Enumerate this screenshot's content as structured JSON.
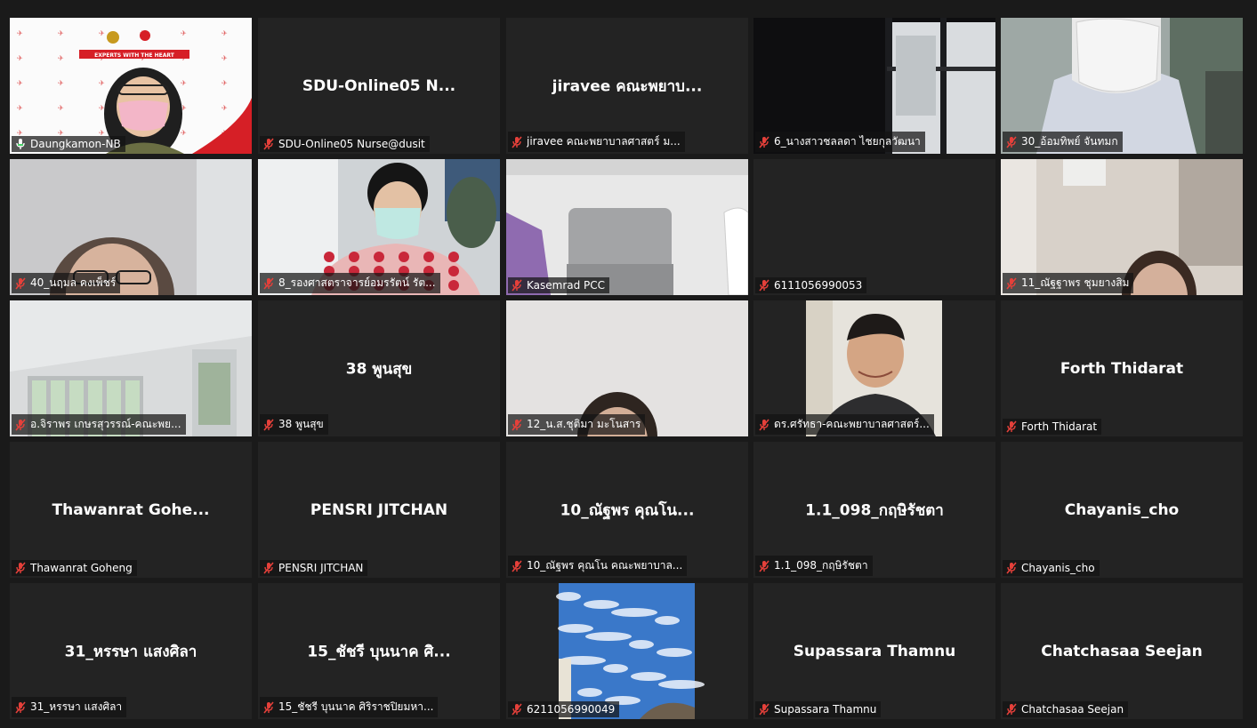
{
  "tiles": [
    {
      "name": "Daungkamon-NB",
      "display": "",
      "video": "speaker",
      "active": true,
      "mic": "active"
    },
    {
      "name": "SDU-Online05 Nurse@dusit",
      "display": "SDU-Online05  N...",
      "video": "none",
      "mic": "muted"
    },
    {
      "name": "jiravee คณะพยาบาลศาสตร์ ม...",
      "display": "jiravee คณะพยาบ...",
      "video": "none",
      "mic": "muted"
    },
    {
      "name": "6_นางสาวชลลดา  ไชยกุลวัฒนา",
      "display": "",
      "video": "window",
      "mic": "muted"
    },
    {
      "name": "30_อ้อมทิพย์  จันทมก",
      "display": "",
      "video": "mask",
      "mic": "muted"
    },
    {
      "name": "40_นฤมล คงเพ็ชร์",
      "display": "",
      "video": "face1",
      "mic": "muted"
    },
    {
      "name": "8_รองศาสตราจารย์อมรรัตน์ รัต...",
      "display": "",
      "video": "office",
      "mic": "muted"
    },
    {
      "name": "Kasemrad PCC",
      "display": "",
      "video": "chair",
      "mic": "muted"
    },
    {
      "name": "6111056990053",
      "display": "",
      "video": "black",
      "mic": "muted"
    },
    {
      "name": "11_ณัฐฐาพร ชุมยางสิม",
      "display": "",
      "video": "room",
      "mic": "muted"
    },
    {
      "name": "อ.จิราพร เกษรสุวรรณ์-คณะพย...",
      "display": "",
      "video": "ceiling",
      "mic": "muted"
    },
    {
      "name": "38 พูนสุข",
      "display": "38 พูนสุข",
      "video": "none",
      "mic": "muted"
    },
    {
      "name": "12_น.ส.ชุติมา มะโนสาร",
      "display": "",
      "video": "face2",
      "mic": "muted"
    },
    {
      "name": "ดร.ศรัทธา-คณะพยาบาลศาสตร์...",
      "display": "",
      "video": "man",
      "mic": "muted"
    },
    {
      "name": "Forth Thidarat",
      "display": "Forth Thidarat",
      "video": "none",
      "mic": "muted"
    },
    {
      "name": "Thawanrat Goheng",
      "display": "Thawanrat  Gohe...",
      "video": "none",
      "mic": "muted"
    },
    {
      "name": "PENSRI JITCHAN",
      "display": "PENSRI JITCHAN",
      "video": "none",
      "mic": "muted"
    },
    {
      "name": "10_ณัฐพร คุณโน คณะพยาบาล...",
      "display": "10_ณัฐพร คุณโน...",
      "video": "none",
      "mic": "muted"
    },
    {
      "name": "1.1_098_กฤษิรัชตา",
      "display": "1.1_098_กฤษิรัชตา",
      "video": "none",
      "mic": "muted"
    },
    {
      "name": "Chayanis_cho",
      "display": "Chayanis_cho",
      "video": "none",
      "mic": "muted"
    },
    {
      "name": "31_หรรษา แสงศิลา",
      "display": "31_หรรษา แสงศิลา",
      "video": "none",
      "mic": "muted"
    },
    {
      "name": "15_ชัชรี บุนนาค ศิริราชปิยมหา...",
      "display": "15_ชัชรี บุนนาค ศิ...",
      "video": "none",
      "mic": "muted"
    },
    {
      "name": "6211056990049",
      "display": "",
      "video": "sky",
      "mic": "muted"
    },
    {
      "name": "Supassara Thamnu",
      "display": "Supassara Thamnu",
      "video": "none",
      "mic": "muted"
    },
    {
      "name": "Chatchasaa Seejan",
      "display": "Chatchasaa Seejan",
      "video": "none",
      "mic": "muted"
    }
  ],
  "speaker_banner": {
    "text": "EXPERTS WITH THE HEART"
  },
  "colors": {
    "active_border": "#c7e36a",
    "muted": "#e5403a",
    "tile_bg": "#232323",
    "app_bg": "#1a1a1a"
  }
}
